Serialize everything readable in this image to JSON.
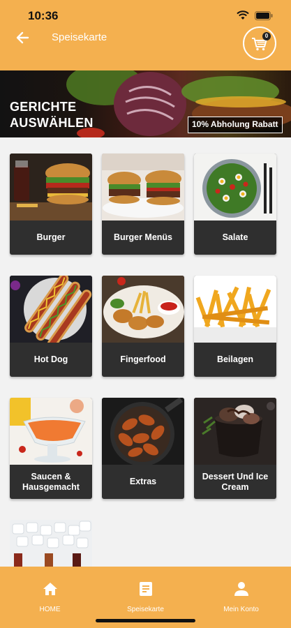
{
  "status_bar": {
    "time": "10:36"
  },
  "header": {
    "title": "Speisekarte",
    "cart_count": "0"
  },
  "banner": {
    "title": "GERICHTE AUSWÄHLEN",
    "promo": "10% Abholung Rabatt"
  },
  "categories": [
    {
      "label": "Burger",
      "image": "burger"
    },
    {
      "label": "Burger Menüs",
      "image": "burger-menu"
    },
    {
      "label": "Salate",
      "image": "salad"
    },
    {
      "label": "Hot Dog",
      "image": "hot-dog"
    },
    {
      "label": "Fingerfood",
      "image": "fingerfood"
    },
    {
      "label": "Beilagen",
      "image": "fries"
    },
    {
      "label": "Saucen & Hausgemacht",
      "image": "sauce"
    },
    {
      "label": "Extras",
      "image": "wings"
    },
    {
      "label": "Dessert Und Ice Cream",
      "image": "dessert"
    },
    {
      "label": "",
      "image": "drinks"
    }
  ],
  "bottom_nav": [
    {
      "label": "HOME",
      "icon": "home-icon"
    },
    {
      "label": "Speisekarte",
      "icon": "menu-icon"
    },
    {
      "label": "Mein Konto",
      "icon": "account-icon"
    }
  ],
  "colors": {
    "accent": "#f4b04f",
    "card": "#2f2f2f",
    "background": "#f2f2f2"
  }
}
